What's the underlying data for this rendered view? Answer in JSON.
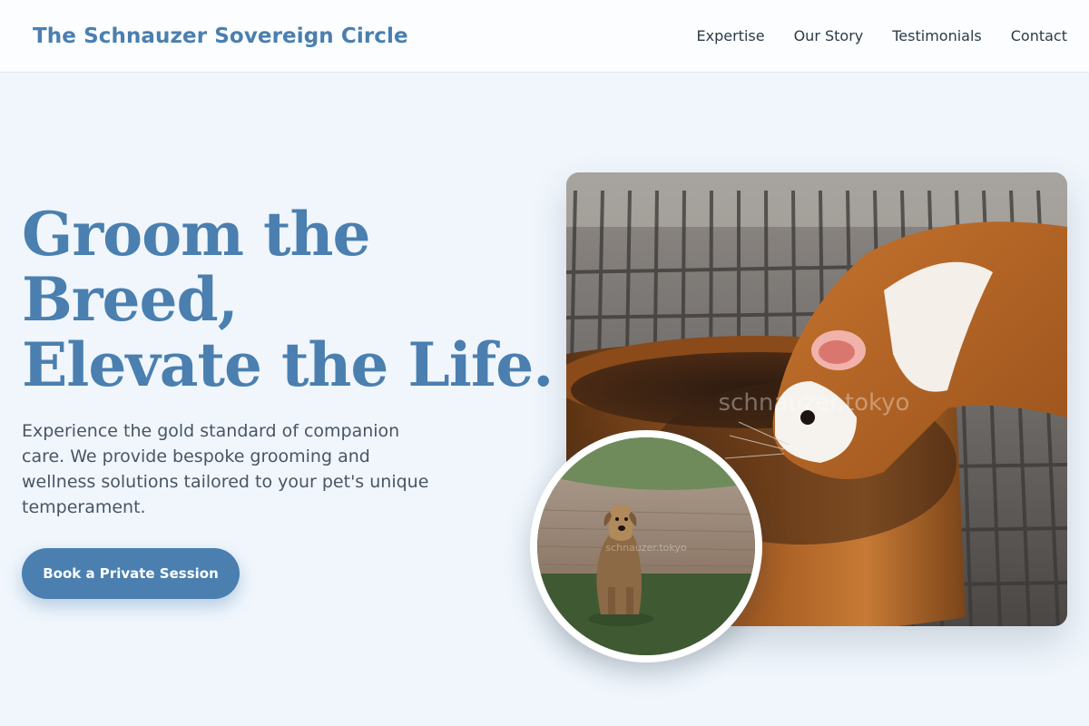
{
  "header": {
    "brand": "The Schnauzer Sovereign Circle",
    "nav": [
      {
        "label": "Expertise"
      },
      {
        "label": "Our Story"
      },
      {
        "label": "Testimonials"
      },
      {
        "label": "Contact"
      }
    ]
  },
  "hero": {
    "title_lines": [
      "Groom the",
      "Breed,",
      "Elevate the Life."
    ],
    "description": "Experience the gold standard of companion care. We provide bespoke grooming and wellness solutions tailored to your pet's unique temperament.",
    "cta_label": "Book a Private Session"
  },
  "images": {
    "main_watermark": "schnauzer.tokyo",
    "inset_watermark": "schnauzer.tokyo"
  },
  "colors": {
    "accent": "#4a7fb0",
    "background": "#f0f6fc",
    "header_bg": "#fbfdfe",
    "body_text": "#4a5563"
  }
}
